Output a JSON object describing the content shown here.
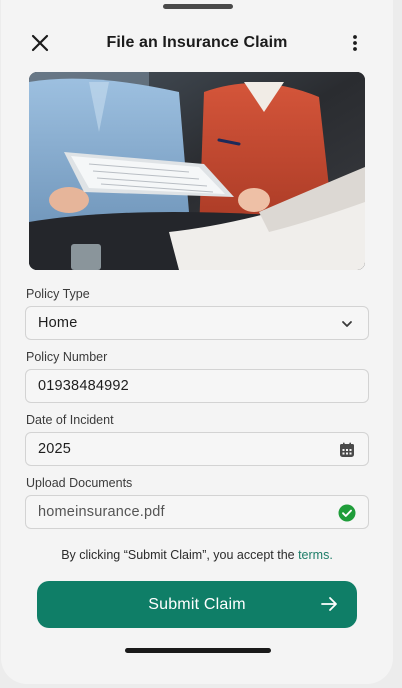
{
  "header": {
    "title": "File an Insurance Claim",
    "close_icon": "close-icon",
    "menu_icon": "more-vertical-icon"
  },
  "hero": {
    "image": "photo of two people reviewing a document on a clipboard, one holding a pen"
  },
  "form": {
    "policy_type": {
      "label": "Policy Type",
      "value": "Home",
      "icon": "chevron-down-icon"
    },
    "policy_number": {
      "label": "Policy Number",
      "value": "01938484992"
    },
    "date_of_incident": {
      "label": "Date of Incident",
      "value": "2025",
      "icon": "calendar-icon"
    },
    "upload_documents": {
      "label": "Upload Documents",
      "value": "homeinsurance.pdf",
      "icon": "check-circle-icon"
    }
  },
  "terms": {
    "text": "By clicking “Submit Claim”, you accept the ",
    "link": "terms."
  },
  "submit": {
    "label": "Submit Claim",
    "icon": "arrow-right-icon"
  },
  "colors": {
    "accent": "#0f7e67",
    "success": "#1f9d3a"
  }
}
